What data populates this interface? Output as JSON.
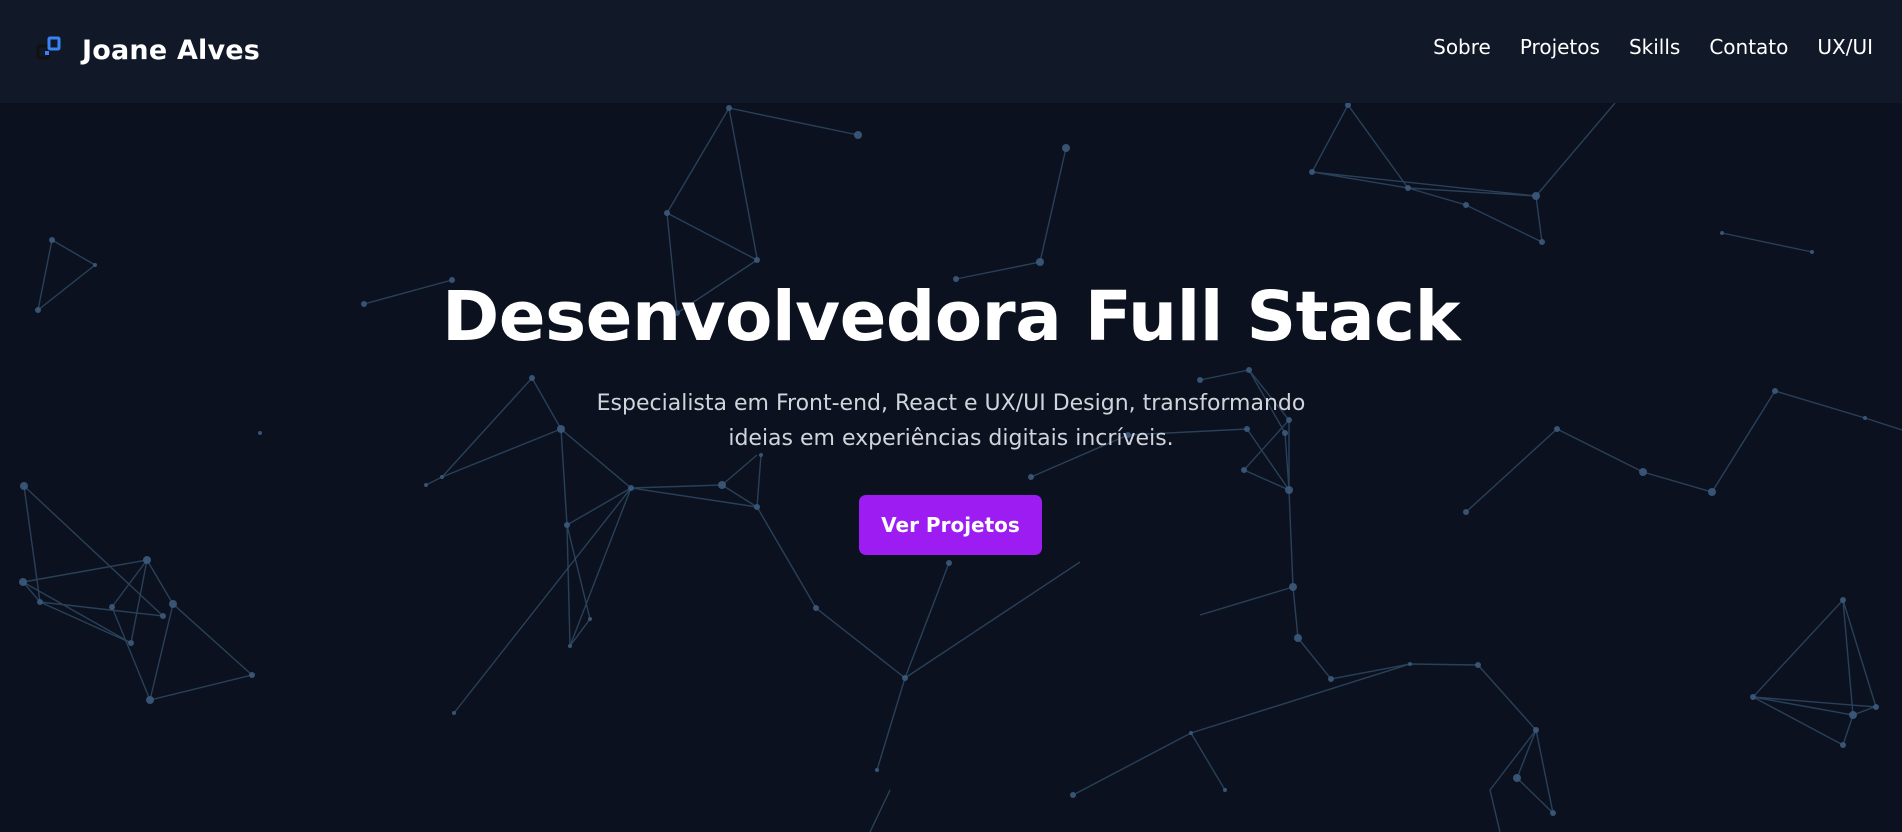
{
  "header": {
    "logo_icon": "code-logo-icon",
    "brand_name": "Joane Alves",
    "nav": [
      {
        "label": "Sobre"
      },
      {
        "label": "Projetos"
      },
      {
        "label": "Skills"
      },
      {
        "label": "Contato"
      },
      {
        "label": "UX/UI"
      }
    ]
  },
  "hero": {
    "title": "Desenvolvedora Full Stack",
    "subtitle": "Especialista em Front-end, React e UX/UI Design, transformando ideias em experiências digitais incríveis.",
    "cta_label": "Ver Projetos"
  },
  "theme": {
    "background": "#0b111e",
    "header_background": "#111827",
    "accent": "#9d1cf2",
    "network_line": "#2f4a66",
    "network_node": "#3b5b7d"
  }
}
